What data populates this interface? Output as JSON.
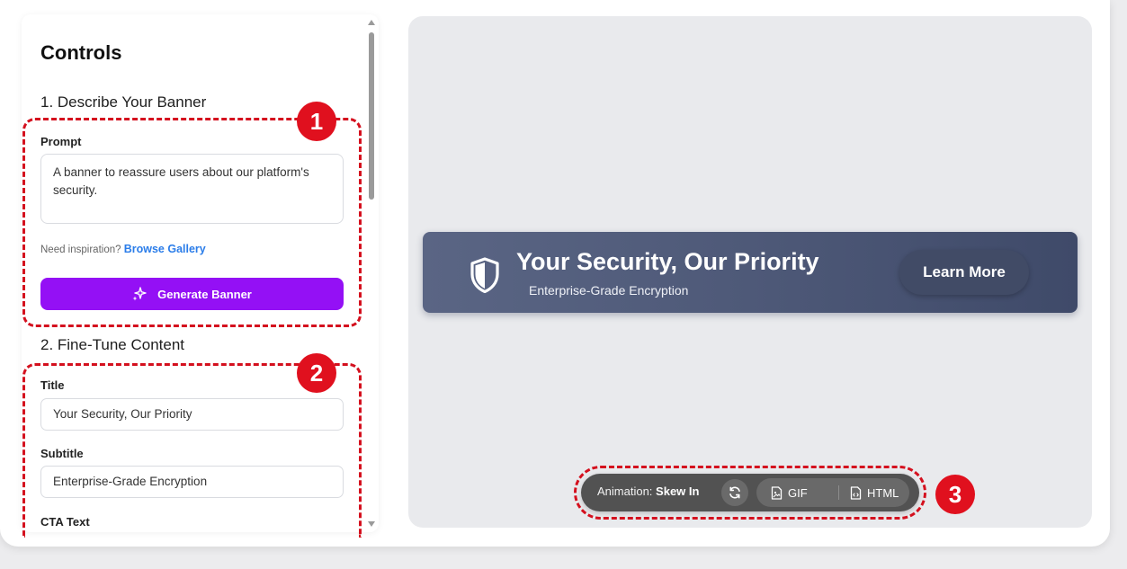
{
  "sidebar": {
    "title": "Controls",
    "section1": "1. Describe Your Banner",
    "prompt_label": "Prompt",
    "prompt_value": "A banner to reassure users about our platform's security.",
    "hint_text": "Need inspiration?",
    "hint_link": "Browse Gallery",
    "generate_label": "Generate Banner",
    "section2": "2. Fine-Tune Content",
    "title_label": "Title",
    "title_value": "Your Security, Our Priority",
    "subtitle_label": "Subtitle",
    "subtitle_value": "Enterprise-Grade Encryption",
    "cta_label": "CTA Text"
  },
  "preview": {
    "banner_title": "Your Security, Our Priority",
    "banner_subtitle": "Enterprise-Grade Encryption",
    "cta": "Learn More",
    "icon": "shield-icon"
  },
  "toolbar": {
    "animation_prefix": "Animation:",
    "animation_value": "Skew In",
    "gif_label": "GIF",
    "html_label": "HTML"
  },
  "annotations": [
    "1",
    "2",
    "3"
  ],
  "colors": {
    "accent": "#9410f5",
    "link": "#2b7de9",
    "annotation": "#d4101e"
  }
}
